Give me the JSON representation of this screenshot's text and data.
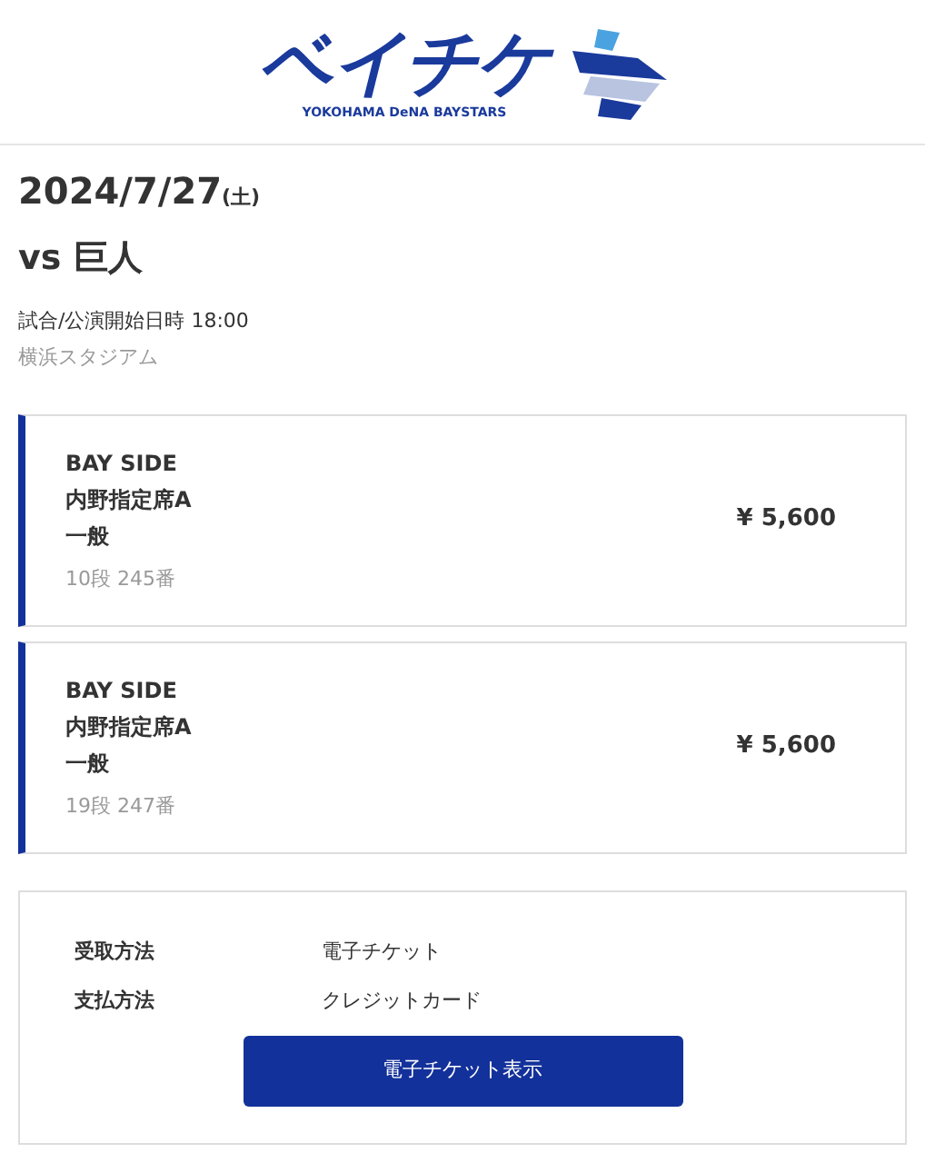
{
  "logo": {
    "title": "ベイチケ",
    "subtitle": "YOKOHAMA DeNA BAYSTARS"
  },
  "event": {
    "date": "2024/7/27",
    "weekday": "(土)",
    "opponent": "vs 巨人",
    "start": "試合/公演開始日時 18:00",
    "venue": "横浜スタジアム"
  },
  "tickets": [
    {
      "area": "BAY SIDE",
      "seat_type": "内野指定席A",
      "category": "一般",
      "seat": "10段 245番",
      "price": "¥ 5,600"
    },
    {
      "area": "BAY SIDE",
      "seat_type": "内野指定席A",
      "category": "一般",
      "seat": "19段 247番",
      "price": "¥ 5,600"
    }
  ],
  "details": [
    {
      "label": "受取方法",
      "value": "電子チケット"
    },
    {
      "label": "支払方法",
      "value": "クレジットカード"
    }
  ],
  "button": "電子チケット表示"
}
